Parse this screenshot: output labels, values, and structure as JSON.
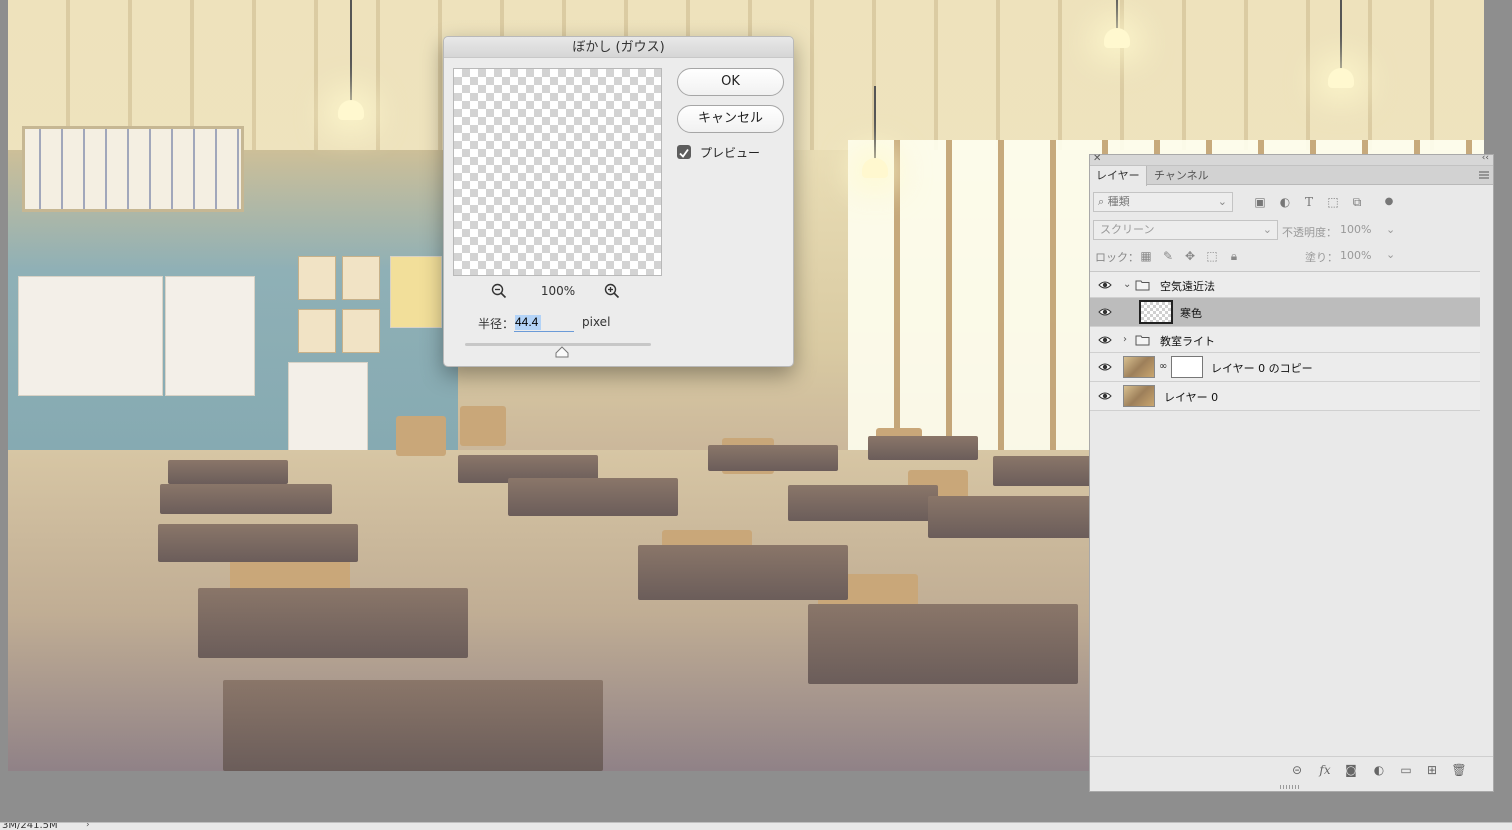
{
  "dialog": {
    "title": "ぼかし (ガウス)",
    "ok_label": "OK",
    "cancel_label": "キャンセル",
    "preview_label": "プレビュー",
    "preview_checked": true,
    "zoom_level": "100%",
    "radius_label": "半径：",
    "radius_value": "44.4",
    "radius_unit": "pixel"
  },
  "layers_panel": {
    "tabs": [
      "レイヤー",
      "チャンネル"
    ],
    "filter_placeholder": "種類",
    "blend_mode": "スクリーン",
    "opacity_label": "不透明度：",
    "opacity_value": "100%",
    "lock_label": "ロック：",
    "fill_label": "塗り：",
    "fill_value": "100%",
    "layers": [
      {
        "name": "空気遠近法",
        "kind": "group",
        "expanded": true,
        "visible": true,
        "selected": false
      },
      {
        "name": "寒色",
        "kind": "layer",
        "indented": true,
        "visible": true,
        "selected": true,
        "thumbnail": "transparent"
      },
      {
        "name": "教室ライト",
        "kind": "group",
        "expanded": false,
        "visible": true,
        "selected": false
      },
      {
        "name": "レイヤー 0 のコピー",
        "kind": "layer",
        "visible": true,
        "selected": false,
        "thumbnail": "photo",
        "has_mask": true
      },
      {
        "name": "レイヤー 0",
        "kind": "layer",
        "visible": true,
        "selected": false,
        "thumbnail": "photo"
      }
    ]
  },
  "statusbar": {
    "doc_size": "3M/241.5M"
  },
  "colors": {
    "accent_selection": "#b3d3f7",
    "selected_layer": "#bcbcbc",
    "dialog_bg": "#ececec",
    "panel_bg": "#e9e9e9"
  }
}
